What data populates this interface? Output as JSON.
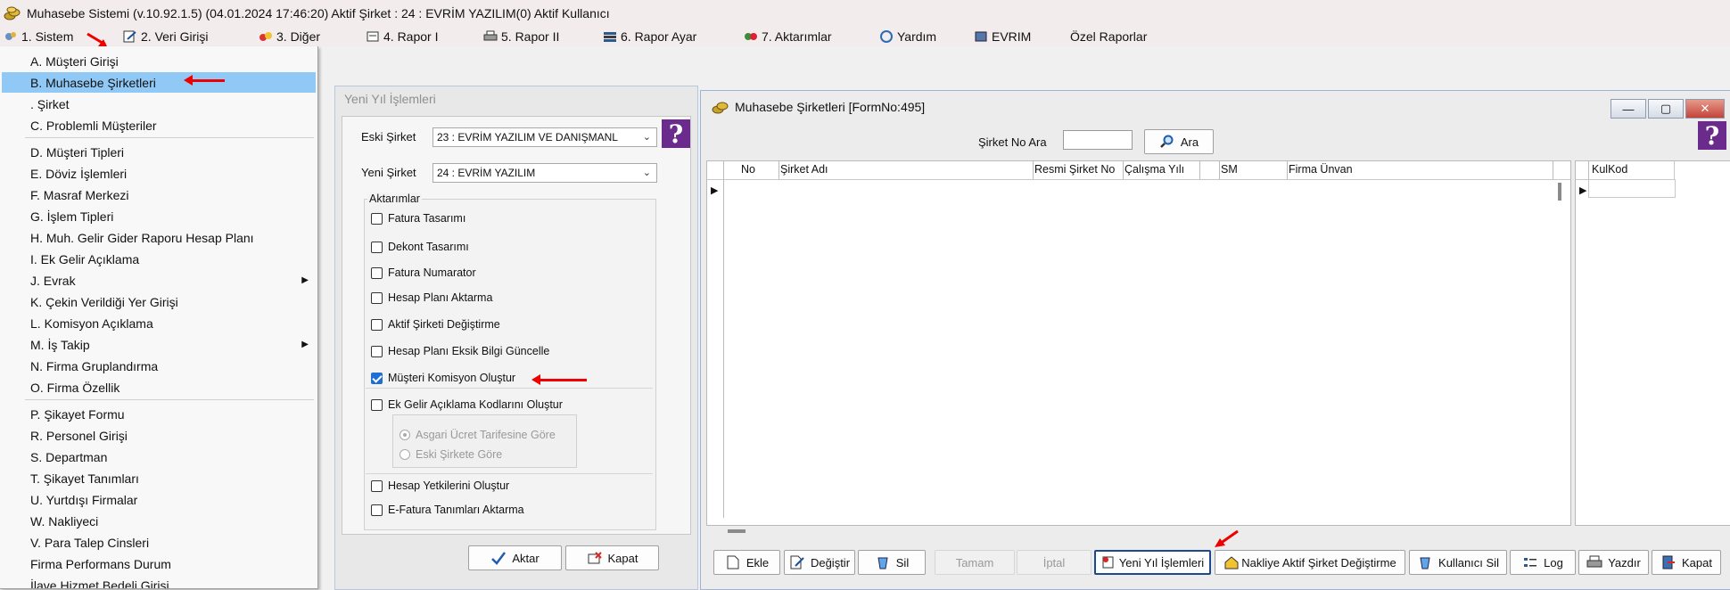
{
  "window": {
    "title": "Muhasebe Sistemi (v.10.92.1.5) (04.01.2024 17:46:20) Aktif Şirket : 24 : EVRİM YAZILIM(0) Aktif Kullanıcı"
  },
  "menubar": {
    "items": [
      {
        "label": "1.  Sistem",
        "icon": "gear-icon"
      },
      {
        "label": "2.   Veri Girişi",
        "icon": "edit-icon"
      },
      {
        "label": "3.   Diğer",
        "icon": "tools-icon"
      },
      {
        "label": "4.   Rapor I",
        "icon": "report-icon"
      },
      {
        "label": "5.   Rapor II",
        "icon": "printer-icon"
      },
      {
        "label": "6.   Rapor Ayar",
        "icon": "books-icon"
      },
      {
        "label": "7.   Aktarımlar",
        "icon": "transfer-icon"
      },
      {
        "label": "Yardım",
        "icon": "help-icon"
      },
      {
        "label": "EVRIM",
        "icon": "book-icon"
      },
      {
        "label": "Özel Raporlar",
        "icon": ""
      }
    ]
  },
  "dropdown": {
    "items": [
      {
        "label": "A.   Müşteri Girişi"
      },
      {
        "label": "B.   Muhasebe Şirketleri",
        "active": true
      },
      {
        "label": ".    Şirket"
      },
      {
        "label": "C.   Problemli Müşteriler"
      },
      {
        "label": "D.   Müşteri Tipleri"
      },
      {
        "label": "E.   Döviz İşlemleri"
      },
      {
        "label": "F.   Masraf Merkezi"
      },
      {
        "label": "G.   İşlem Tipleri"
      },
      {
        "label": "H.   Muh. Gelir Gider Raporu Hesap Planı"
      },
      {
        "label": "I.   Ek Gelir Açıklama"
      },
      {
        "label": "J.   Evrak",
        "submenu": true
      },
      {
        "label": "K.   Çekin Verildiği Yer Girişi"
      },
      {
        "label": "L.   Komisyon Açıklama"
      },
      {
        "label": "M.   İş Takip",
        "submenu": true
      },
      {
        "label": "N.   Firma Gruplandırma"
      },
      {
        "label": "O.  Firma Özellik"
      },
      {
        "label": "P.   Şikayet Formu"
      },
      {
        "label": "R.   Personel Girişi"
      },
      {
        "label": "S.   Departman"
      },
      {
        "label": "T.   Şikayet Tanımları"
      },
      {
        "label": "U.   Yurtdışı Firmalar"
      },
      {
        "label": "W.   Nakliyeci"
      },
      {
        "label": "V.  Para Talep Cinsleri"
      },
      {
        "label": "Firma Performans Durum"
      },
      {
        "label": "İlave Hizmet Bedeli Girişi"
      }
    ]
  },
  "yeni_yil": {
    "title": "Yeni Yıl İşlemleri",
    "eski_sirket_label": "Eski Şirket",
    "eski_sirket_value": "23 : EVRİM YAZILIM  VE DANIŞMANL",
    "yeni_sirket_label": "Yeni Şirket",
    "yeni_sirket_value": "24 : EVRİM YAZILIM",
    "aktarimlar_label": "Aktarımlar",
    "checkboxes": [
      {
        "label": "Fatura Tasarımı",
        "checked": false
      },
      {
        "label": "Dekont Tasarımı",
        "checked": false
      },
      {
        "label": "Fatura Numarator",
        "checked": false
      },
      {
        "label": "Hesap Planı Aktarma",
        "checked": false
      },
      {
        "label": "Aktif Şirketi Değiştirme",
        "checked": false
      },
      {
        "label": "Hesap Planı Eksik Bilgi Güncelle",
        "checked": false
      },
      {
        "label": "Müşteri Komisyon Oluştur",
        "checked": true
      },
      {
        "label": "Ek Gelir Açıklama Kodlarını Oluştur",
        "checked": false
      }
    ],
    "radios": [
      {
        "label": "Asgari Ücret Tarifesine Göre",
        "selected": true
      },
      {
        "label": "Eski Şirkete Göre",
        "selected": false
      }
    ],
    "checkboxes2": [
      {
        "label": "Hesap Yetkilerini Oluştur",
        "checked": false
      },
      {
        "label": "E-Fatura Tanımları Aktarma",
        "checked": false
      }
    ],
    "aktar_label": "Aktar",
    "kapat_label": "Kapat"
  },
  "muhasebe": {
    "title": "Muhasebe Şirketleri [FormNo:495]",
    "search_label": "Şirket No Ara",
    "search_value": "",
    "ara_label": "Ara",
    "columns": [
      "No",
      "Şirket Adı",
      "Resmi Şirket No",
      "Çalışma Yılı",
      "SM",
      "Firma Ünvan"
    ],
    "side_column": "KulKod",
    "buttons": {
      "ekle": "Ekle",
      "degistir": "Değiştir",
      "sil": "Sil",
      "tamam": "Tamam",
      "iptal": "İptal",
      "yeni_yil": "Yeni Yıl İşlemleri",
      "nakliye": "Nakliye Aktif Şirket Değiştirme",
      "kullanici_sil": "Kullanıcı Sil",
      "log": "Log",
      "yazdir": "Yazdır",
      "kapat": "Kapat"
    }
  },
  "colors": {
    "accent_blue": "#90c8f6",
    "help_purple": "#6a2b8c",
    "annotation_red": "#e00000"
  }
}
